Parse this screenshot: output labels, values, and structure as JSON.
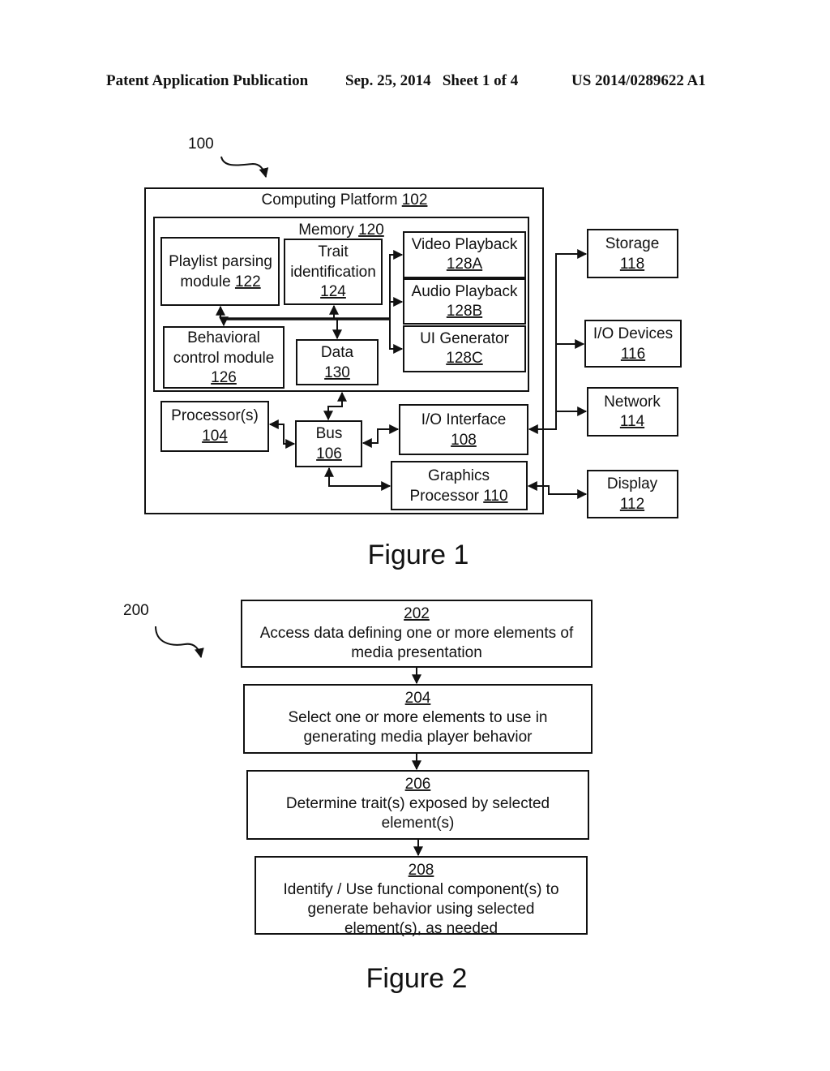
{
  "header": {
    "left": "Patent Application Publication",
    "center": "Sep. 25, 2014   Sheet 1 of 4",
    "right": "US 2014/0289622 A1"
  },
  "figure1": {
    "ref": "100",
    "caption": "Figure 1",
    "platform": {
      "text": "Computing Platform ",
      "num": "102"
    },
    "memory": {
      "text": "Memory ",
      "num": "120"
    },
    "playlist": {
      "line1": "Playlist parsing",
      "line2": "module ",
      "num": "122"
    },
    "trait": {
      "line1": "Trait",
      "line2": "identification",
      "num": "124"
    },
    "video": {
      "line1": "Video Playback",
      "num": "128A"
    },
    "audio": {
      "line1": "Audio Playback",
      "num": "128B"
    },
    "ui": {
      "line1": "UI Generator",
      "num": "128C"
    },
    "behavioral": {
      "line1": "Behavioral",
      "line2": "control module",
      "num": "126"
    },
    "data": {
      "line1": "Data",
      "num": "130"
    },
    "processor": {
      "line1": "Processor(s)",
      "num": "104"
    },
    "bus": {
      "line1": "Bus",
      "num": "106"
    },
    "io_interface": {
      "line1": "I/O Interface",
      "num": "108"
    },
    "graphics": {
      "line1": "Graphics",
      "line2": "Processor ",
      "num": "110"
    },
    "storage": {
      "line1": "Storage",
      "num": "118"
    },
    "io_devices": {
      "line1": "I/O Devices",
      "num": "116"
    },
    "network": {
      "line1": "Network",
      "num": "114"
    },
    "display": {
      "line1": "Display",
      "num": "112"
    }
  },
  "figure2": {
    "ref": "200",
    "caption": "Figure 2",
    "steps": [
      {
        "num": "202",
        "lines": [
          "Access data defining one or more elements of",
          "media presentation"
        ]
      },
      {
        "num": "204",
        "lines": [
          "Select one or more elements to use in",
          "generating media player behavior"
        ]
      },
      {
        "num": "206",
        "lines": [
          "Determine trait(s) exposed by selected",
          "element(s)"
        ]
      },
      {
        "num": "208",
        "lines": [
          "Identify / Use functional component(s) to",
          "generate behavior using selected",
          "element(s), as needed"
        ]
      }
    ]
  }
}
